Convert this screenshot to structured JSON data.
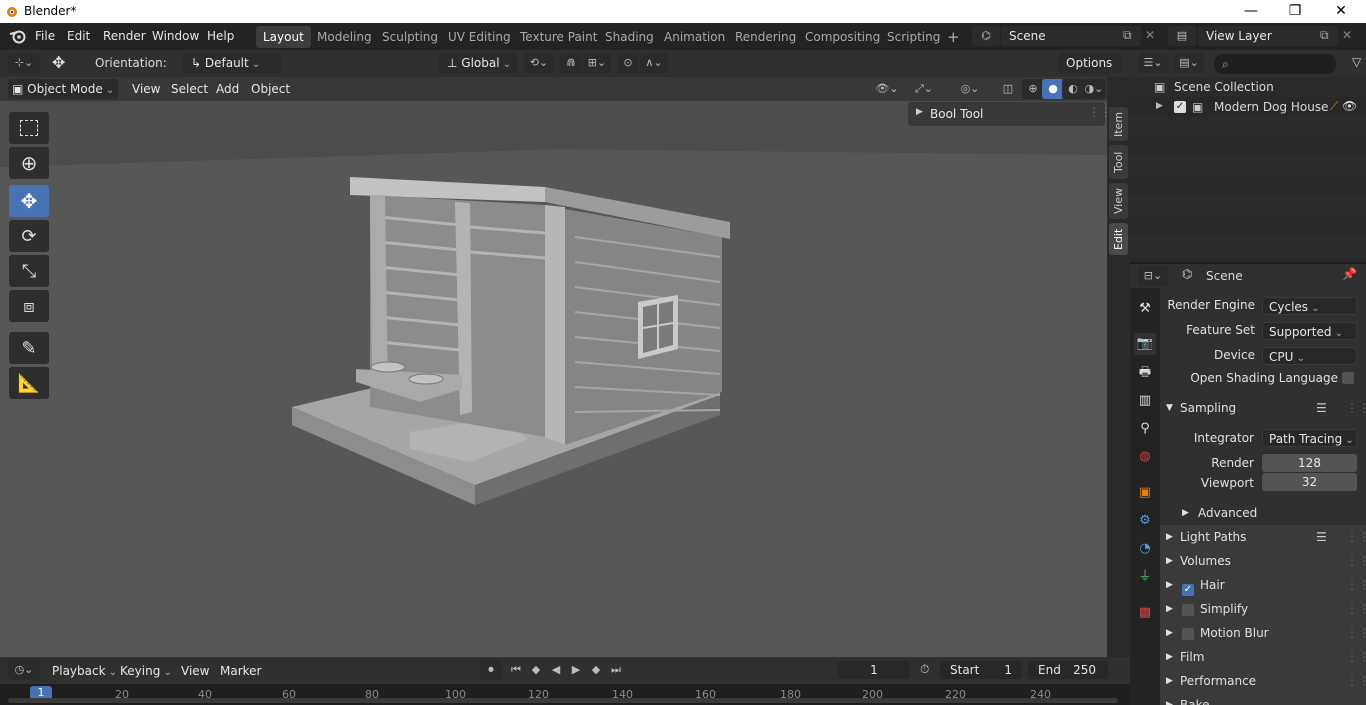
{
  "window": {
    "title": "Blender*",
    "minimize": "—",
    "maximize": "❐",
    "close": "✕"
  },
  "menu": {
    "items": [
      "File",
      "Edit",
      "Render",
      "Window",
      "Help"
    ]
  },
  "workspaces": [
    "Layout",
    "Modeling",
    "Sculpting",
    "UV Editing",
    "Texture Paint",
    "Shading",
    "Animation",
    "Rendering",
    "Compositing",
    "Scripting"
  ],
  "add_workspace": "+",
  "scene_field": "Scene",
  "view_layer_field": "View Layer",
  "header": {
    "orientation_label": "Orientation:",
    "orientation_value": "Default",
    "transform": "Global",
    "options": "Options"
  },
  "viewport_header": {
    "mode": "Object Mode",
    "menus": [
      "View",
      "Select",
      "Add",
      "Object"
    ]
  },
  "bool_tool": "Bool Tool",
  "npanel_tabs": [
    "Item",
    "Tool",
    "View",
    "Edit"
  ],
  "outliner": {
    "collection": "Scene Collection",
    "object": "Modern Dog House"
  },
  "properties": {
    "context": "Scene",
    "render_engine_label": "Render Engine",
    "render_engine": "Cycles",
    "feature_set_label": "Feature Set",
    "feature_set": "Supported",
    "device_label": "Device",
    "device": "CPU",
    "osl_label": "Open Shading Language",
    "sampling": "Sampling",
    "integrator_label": "Integrator",
    "integrator": "Path Tracing",
    "render_label": "Render",
    "render_samples": "128",
    "viewport_label": "Viewport",
    "viewport_samples": "32",
    "advanced": "Advanced",
    "light_paths": "Light Paths",
    "volumes": "Volumes",
    "hair": "Hair",
    "simplify": "Simplify",
    "motion_blur": "Motion Blur",
    "film": "Film",
    "performance": "Performance",
    "bake": "Bake"
  },
  "timeline": {
    "playback": "Playback",
    "keying": "Keying",
    "view": "View",
    "marker": "Marker",
    "current_frame": "1",
    "start_label": "Start",
    "start": "1",
    "end_label": "End",
    "end": "250",
    "ticks": [
      "1",
      "20",
      "40",
      "60",
      "80",
      "100",
      "120",
      "140",
      "160",
      "180",
      "200",
      "220",
      "240"
    ]
  },
  "colors": {
    "accent": "#4772b3",
    "object_gray": "#9a9a9a"
  }
}
